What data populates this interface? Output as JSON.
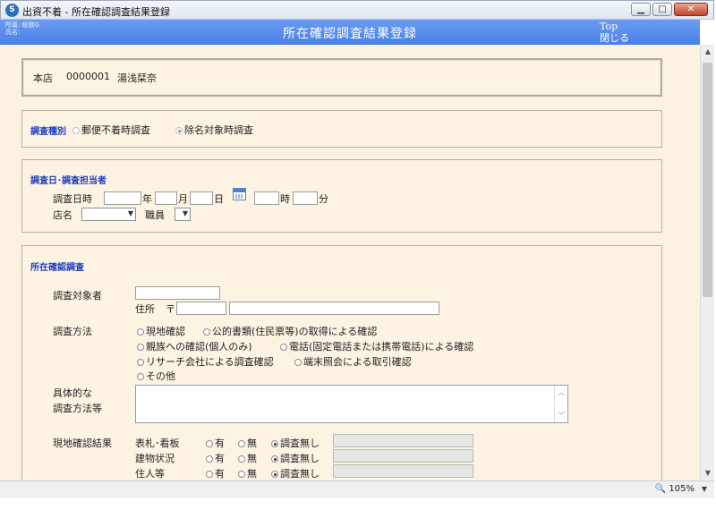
{
  "window": {
    "title": "出資不着 - 所在確認調査結果登録",
    "app_icon_letter": "S"
  },
  "header": {
    "affiliation": "所属: 総務G",
    "name_label": "氏名:",
    "title": "所在確認調査結果登録",
    "top_link": "Top",
    "close_link": "閉じる"
  },
  "info": {
    "branch": "本店",
    "member_no": "0000001",
    "member_name": "湯浅栞奈"
  },
  "survey_type": {
    "label": "調査種別",
    "options": [
      "郵便不着時調査",
      "除名対象時調査"
    ],
    "selected": 1
  },
  "survey_date": {
    "title": "調査日･調査担当者",
    "datetime_label": "調査日時",
    "year_unit": "年",
    "month_unit": "月",
    "day_unit": "日",
    "hour_unit": "時",
    "minute_unit": "分",
    "store_label": "店名",
    "staff_label": "職員"
  },
  "location": {
    "title": "所在確認調査",
    "target_label": "調査対象者",
    "address_label": "住所",
    "postal_mark": "〒",
    "method_label": "調査方法",
    "methods": [
      "現地確認",
      "公的書類(住民票等)の取得による確認",
      "親族への確認(個人のみ)",
      "電話(固定電話または携帯電話)による確認",
      "リサーチ会社による調査確認",
      "端末照会による取引確認",
      "その他"
    ],
    "detail_label_1": "具体的な",
    "detail_label_2": "調査方法等",
    "result_label": "現地確認結果",
    "result_rows": [
      {
        "label": "表札･看板",
        "selected": 2
      },
      {
        "label": "建物状況",
        "selected": 2
      },
      {
        "label": "住人等",
        "selected": 2
      }
    ],
    "result_options": [
      "有",
      "無",
      "調査無し"
    ]
  },
  "status": {
    "zoom": "105%"
  }
}
